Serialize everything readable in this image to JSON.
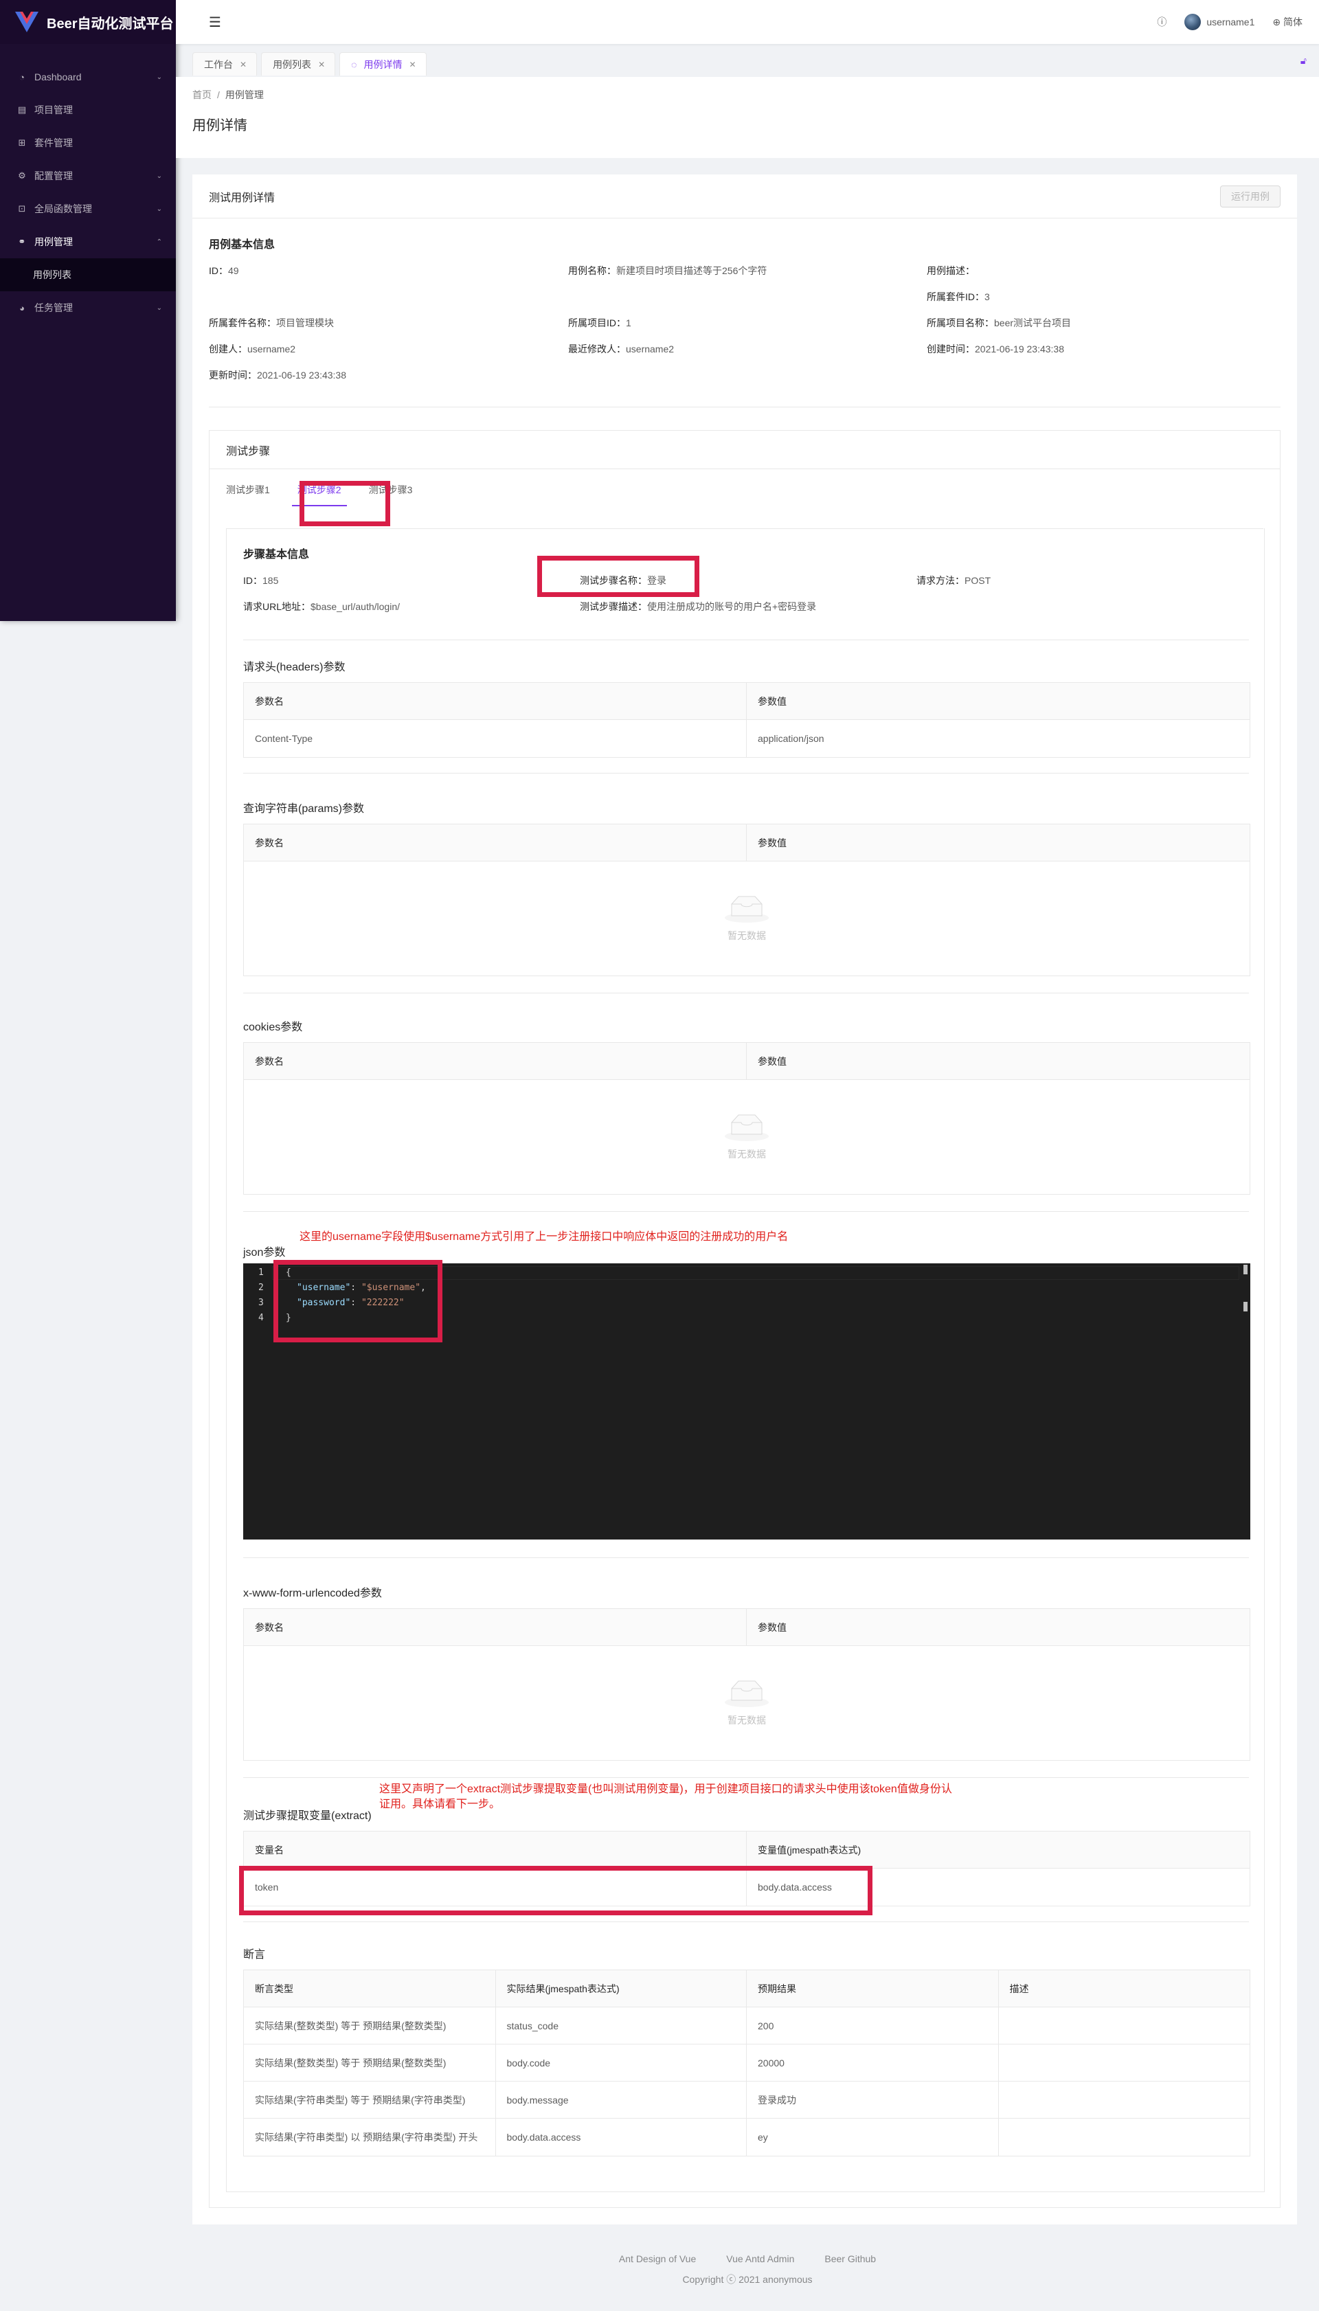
{
  "app": {
    "title": "Beer自动化测试平台"
  },
  "sidebar": {
    "items": [
      {
        "label": "Dashboard",
        "icon": "dashboard-icon",
        "has_children": true
      },
      {
        "label": "项目管理",
        "icon": "project-icon",
        "has_children": false
      },
      {
        "label": "套件管理",
        "icon": "suite-icon",
        "has_children": false
      },
      {
        "label": "配置管理",
        "icon": "gear-icon",
        "has_children": true
      },
      {
        "label": "全局函数管理",
        "icon": "code-icon",
        "has_children": true
      },
      {
        "label": "用例管理",
        "icon": "link-icon",
        "has_children": true,
        "open": true
      },
      {
        "label": "用例列表",
        "sub": true
      },
      {
        "label": "任务管理",
        "icon": "pie-chart-icon",
        "has_children": true
      }
    ]
  },
  "header": {
    "username": "username1",
    "language": "简体"
  },
  "page_tabs": [
    {
      "label": "工作台"
    },
    {
      "label": "用例列表"
    },
    {
      "label": "用例详情",
      "active": true
    }
  ],
  "breadcrumb": {
    "home": "首页",
    "current": "用例管理"
  },
  "page_title": "用例详情",
  "card": {
    "title": "测试用例详情",
    "run_button": "运行用例"
  },
  "basic_info": {
    "title": "用例基本信息",
    "id": {
      "label": "ID：",
      "value": "49"
    },
    "name": {
      "label": "用例名称：",
      "value": "新建项目时项目描述等于256个字符"
    },
    "desc": {
      "label": "用例描述：",
      "value": ""
    },
    "suite_id": {
      "label": "所属套件ID：",
      "value": "3"
    },
    "suite_name": {
      "label": "所属套件名称：",
      "value": "项目管理模块"
    },
    "project_id": {
      "label": "所属项目ID：",
      "value": "1"
    },
    "project_name": {
      "label": "所属项目名称：",
      "value": "beer测试平台项目"
    },
    "creator": {
      "label": "创建人：",
      "value": "username2"
    },
    "modifier": {
      "label": "最近修改人：",
      "value": "username2"
    },
    "created": {
      "label": "创建时间：",
      "value": "2021-06-19 23:43:38"
    },
    "updated": {
      "label": "更新时间：",
      "value": "2021-06-19 23:43:38"
    }
  },
  "steps": {
    "title": "测试步骤",
    "tabs": [
      "测试步骤1",
      "测试步骤2",
      "测试步骤3"
    ],
    "active_tab": 1,
    "basic": {
      "title": "步骤基本信息",
      "id": {
        "label": "ID：",
        "value": "185"
      },
      "name": {
        "label": "测试步骤名称：",
        "value": "登录"
      },
      "method": {
        "label": "请求方法：",
        "value": "POST"
      },
      "url": {
        "label": "请求URL地址：",
        "value": "$base_url/auth/login/"
      },
      "desc": {
        "label": "测试步骤描述：",
        "value": "使用注册成功的账号的用户名+密码登录"
      }
    },
    "headers": {
      "title": "请求头(headers)参数",
      "columns": [
        "参数名",
        "参数值"
      ],
      "rows": [
        [
          "Content-Type",
          "application/json"
        ]
      ]
    },
    "params": {
      "title": "查询字符串(params)参数",
      "columns": [
        "参数名",
        "参数值"
      ],
      "empty": "暂无数据"
    },
    "cookies": {
      "title": "cookies参数",
      "columns": [
        "参数名",
        "参数值"
      ],
      "empty": "暂无数据"
    },
    "json": {
      "title": "json参数",
      "lines": [
        "1",
        "2",
        "3",
        "4"
      ],
      "code": {
        "open": "{",
        "k1": "\"username\"",
        "v1": "\"$username\"",
        "k2": "\"password\"",
        "v2": "\"222222\"",
        "close": "}"
      }
    },
    "form": {
      "title": "x-www-form-urlencoded参数",
      "columns": [
        "参数名",
        "参数值"
      ],
      "empty": "暂无数据"
    },
    "extract": {
      "title": "测试步骤提取变量(extract)",
      "columns": [
        "变量名",
        "变量值(jmespath表达式)"
      ],
      "rows": [
        [
          "token",
          "body.data.access"
        ]
      ]
    },
    "asserts": {
      "title": "断言",
      "columns": [
        "断言类型",
        "实际结果(jmespath表达式)",
        "预期结果",
        "描述"
      ],
      "rows": [
        [
          "实际结果(整数类型) 等于 预期结果(整数类型)",
          "status_code",
          "200",
          ""
        ],
        [
          "实际结果(整数类型) 等于 预期结果(整数类型)",
          "body.code",
          "20000",
          ""
        ],
        [
          "实际结果(字符串类型) 等于 预期结果(字符串类型)",
          "body.message",
          "登录成功",
          ""
        ],
        [
          "实际结果(字符串类型) 以 预期结果(字符串类型) 开头",
          "body.data.access",
          "ey",
          ""
        ]
      ]
    }
  },
  "annotations": {
    "note1": "这里的username字段使用$username方式引用了上一步注册接口中响应体中返回的注册成功的用户名",
    "note2_line1": "这里又声明了一个extract测试步骤提取变量(也叫测试用例变量)，用于创建项目接口的请求头中使用该token值做身份认",
    "note2_line2": "证用。具体请看下一步。"
  },
  "footer": {
    "links": [
      "Ant Design of Vue",
      "Vue Antd Admin",
      "Beer Github"
    ],
    "copyright": "Copyright ⓒ 2021 anonymous"
  },
  "colors": {
    "primary": "#7c3aed",
    "sider": "#1d0e30",
    "annotation": "#d81e47"
  }
}
